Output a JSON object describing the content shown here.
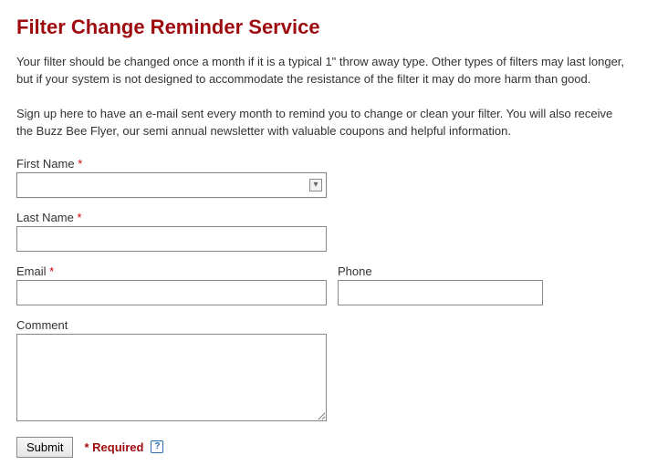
{
  "heading": "Filter Change Reminder Service",
  "intro1": "Your filter should be changed once a month if it is a typical 1\" throw away type. Other types of filters may last longer, but if your system is not designed to accommodate the resistance of the filter it may do more harm than good.",
  "intro2": "Sign up here to have an e-mail sent every month to remind you to change or clean your filter. You will also receive the Buzz Bee Flyer, our semi annual newsletter with valuable coupons and helpful information.",
  "fields": {
    "first_name": {
      "label": "First Name",
      "required": true,
      "value": ""
    },
    "last_name": {
      "label": "Last Name",
      "required": true,
      "value": ""
    },
    "email": {
      "label": "Email",
      "required": true,
      "value": ""
    },
    "phone": {
      "label": "Phone",
      "required": false,
      "value": ""
    },
    "comment": {
      "label": "Comment",
      "required": false,
      "value": ""
    }
  },
  "submit_label": "Submit",
  "required_note": "* Required",
  "required_star": "*",
  "help_glyph": "?",
  "autofill_glyph": "▾"
}
